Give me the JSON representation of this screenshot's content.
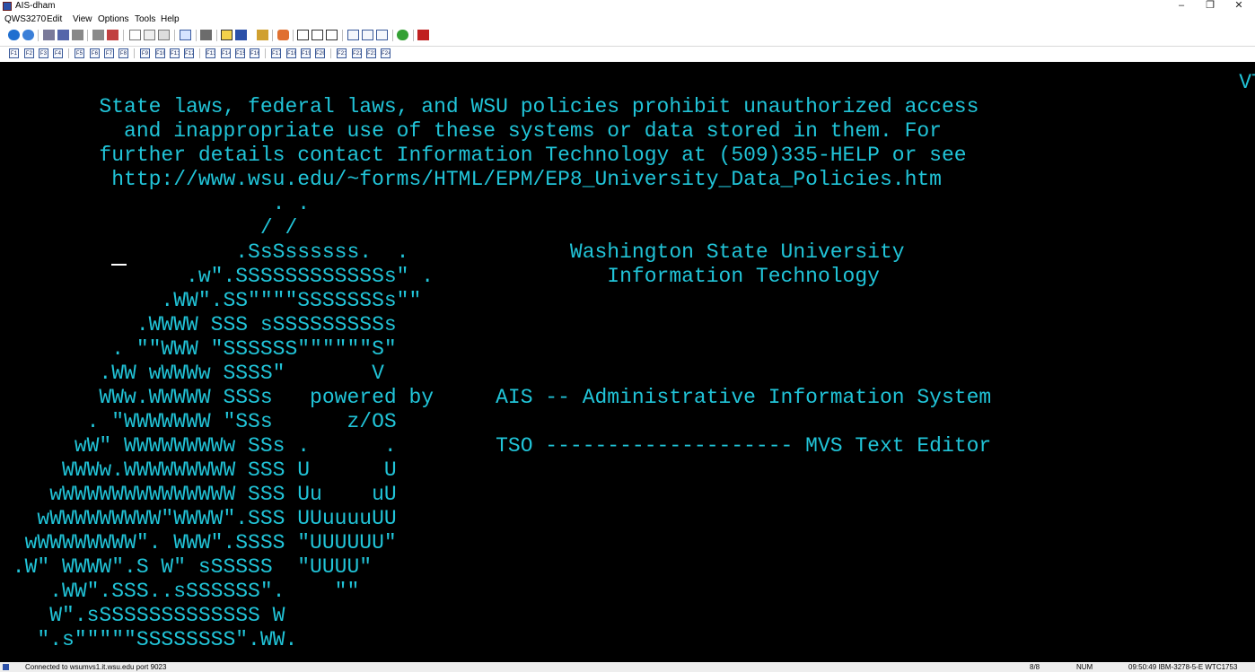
{
  "window": {
    "title": "AIS-dham",
    "minimize_glyph": "–",
    "restore_glyph": "❐",
    "close_glyph": "✕"
  },
  "menu": {
    "items": [
      "QWS3270",
      "Edit",
      "View",
      "Options",
      "Tools",
      "Help"
    ]
  },
  "pf_keys": [
    "F1",
    "F2",
    "F3",
    "F4",
    "F5",
    "F6",
    "F7",
    "F8",
    "F9",
    "F10",
    "F11",
    "F12",
    "F13",
    "F14",
    "F15",
    "F16",
    "F17",
    "F18",
    "F19",
    "F20",
    "F21",
    "F22",
    "F23",
    "F24"
  ],
  "terminal": {
    "colors": {
      "foreground": "#21c4d8",
      "background": "#000000"
    },
    "lines": [
      "                                                                                                    VTAM010",
      "        State laws, federal laws, and WSU policies prohibit unauthorized access",
      "          and inappropriate use of these systems or data stored in them. For",
      "        further details contact Information Technology at (509)335-HELP or see",
      "         http://www.wsu.edu/~forms/HTML/EPM/EP8_University_Data_Policies.htm",
      "                      . .",
      "                     / /",
      "                   .SsSssssss.  .             Washington State University",
      "               .w\".SSSSSSSSSSSSs\" .              Information Technology",
      "             .WW\".SS\"\"\"\"SSSSSSSs\"\"",
      "           .WWWW SSS sSSSSSSSSSs",
      "         . \"\"WWW \"SSSSSS\"\"\"\"\"\"S\"",
      "        .WW wWWWw SSSS\"       V",
      "        WWw.WWWWW SSSs   powered by     AIS -- Administrative Information System",
      "       . \"WWWWWWW \"SSs      z/OS",
      "      wW\" WWWWWWWWw SSs .      .        TSO -------------------- MVS Text Editor",
      "     WWWw.WWWWWWWWW SSS U      U",
      "    wWWWWWWWWWWWWWW SSS Uu    uU",
      "   wWWWWWWWWW\"WWWW\".SSS UUuuuuUU",
      "  wWWWWWWWW\". WWW\".SSSS \"UUUUUU\"",
      " .W\" WWWW\".S W\" sSSSSS  \"UUUU\"",
      "    .WW\".SSS..sSSSSSS\".    \"\"",
      "    W\".sSSSSSSSSSSSSS W",
      "   \".s\"\"\"\"\"SSSSSSSS\".WW.",
      "                                        =>"
    ]
  },
  "status": {
    "connection": "Connected to wsumvs1.it.wsu.edu port 9023",
    "cursor_pos": "8/8",
    "num_lock": "NUM",
    "session_info": "09:50:49  IBM-3278-5-E   WTC1753"
  }
}
